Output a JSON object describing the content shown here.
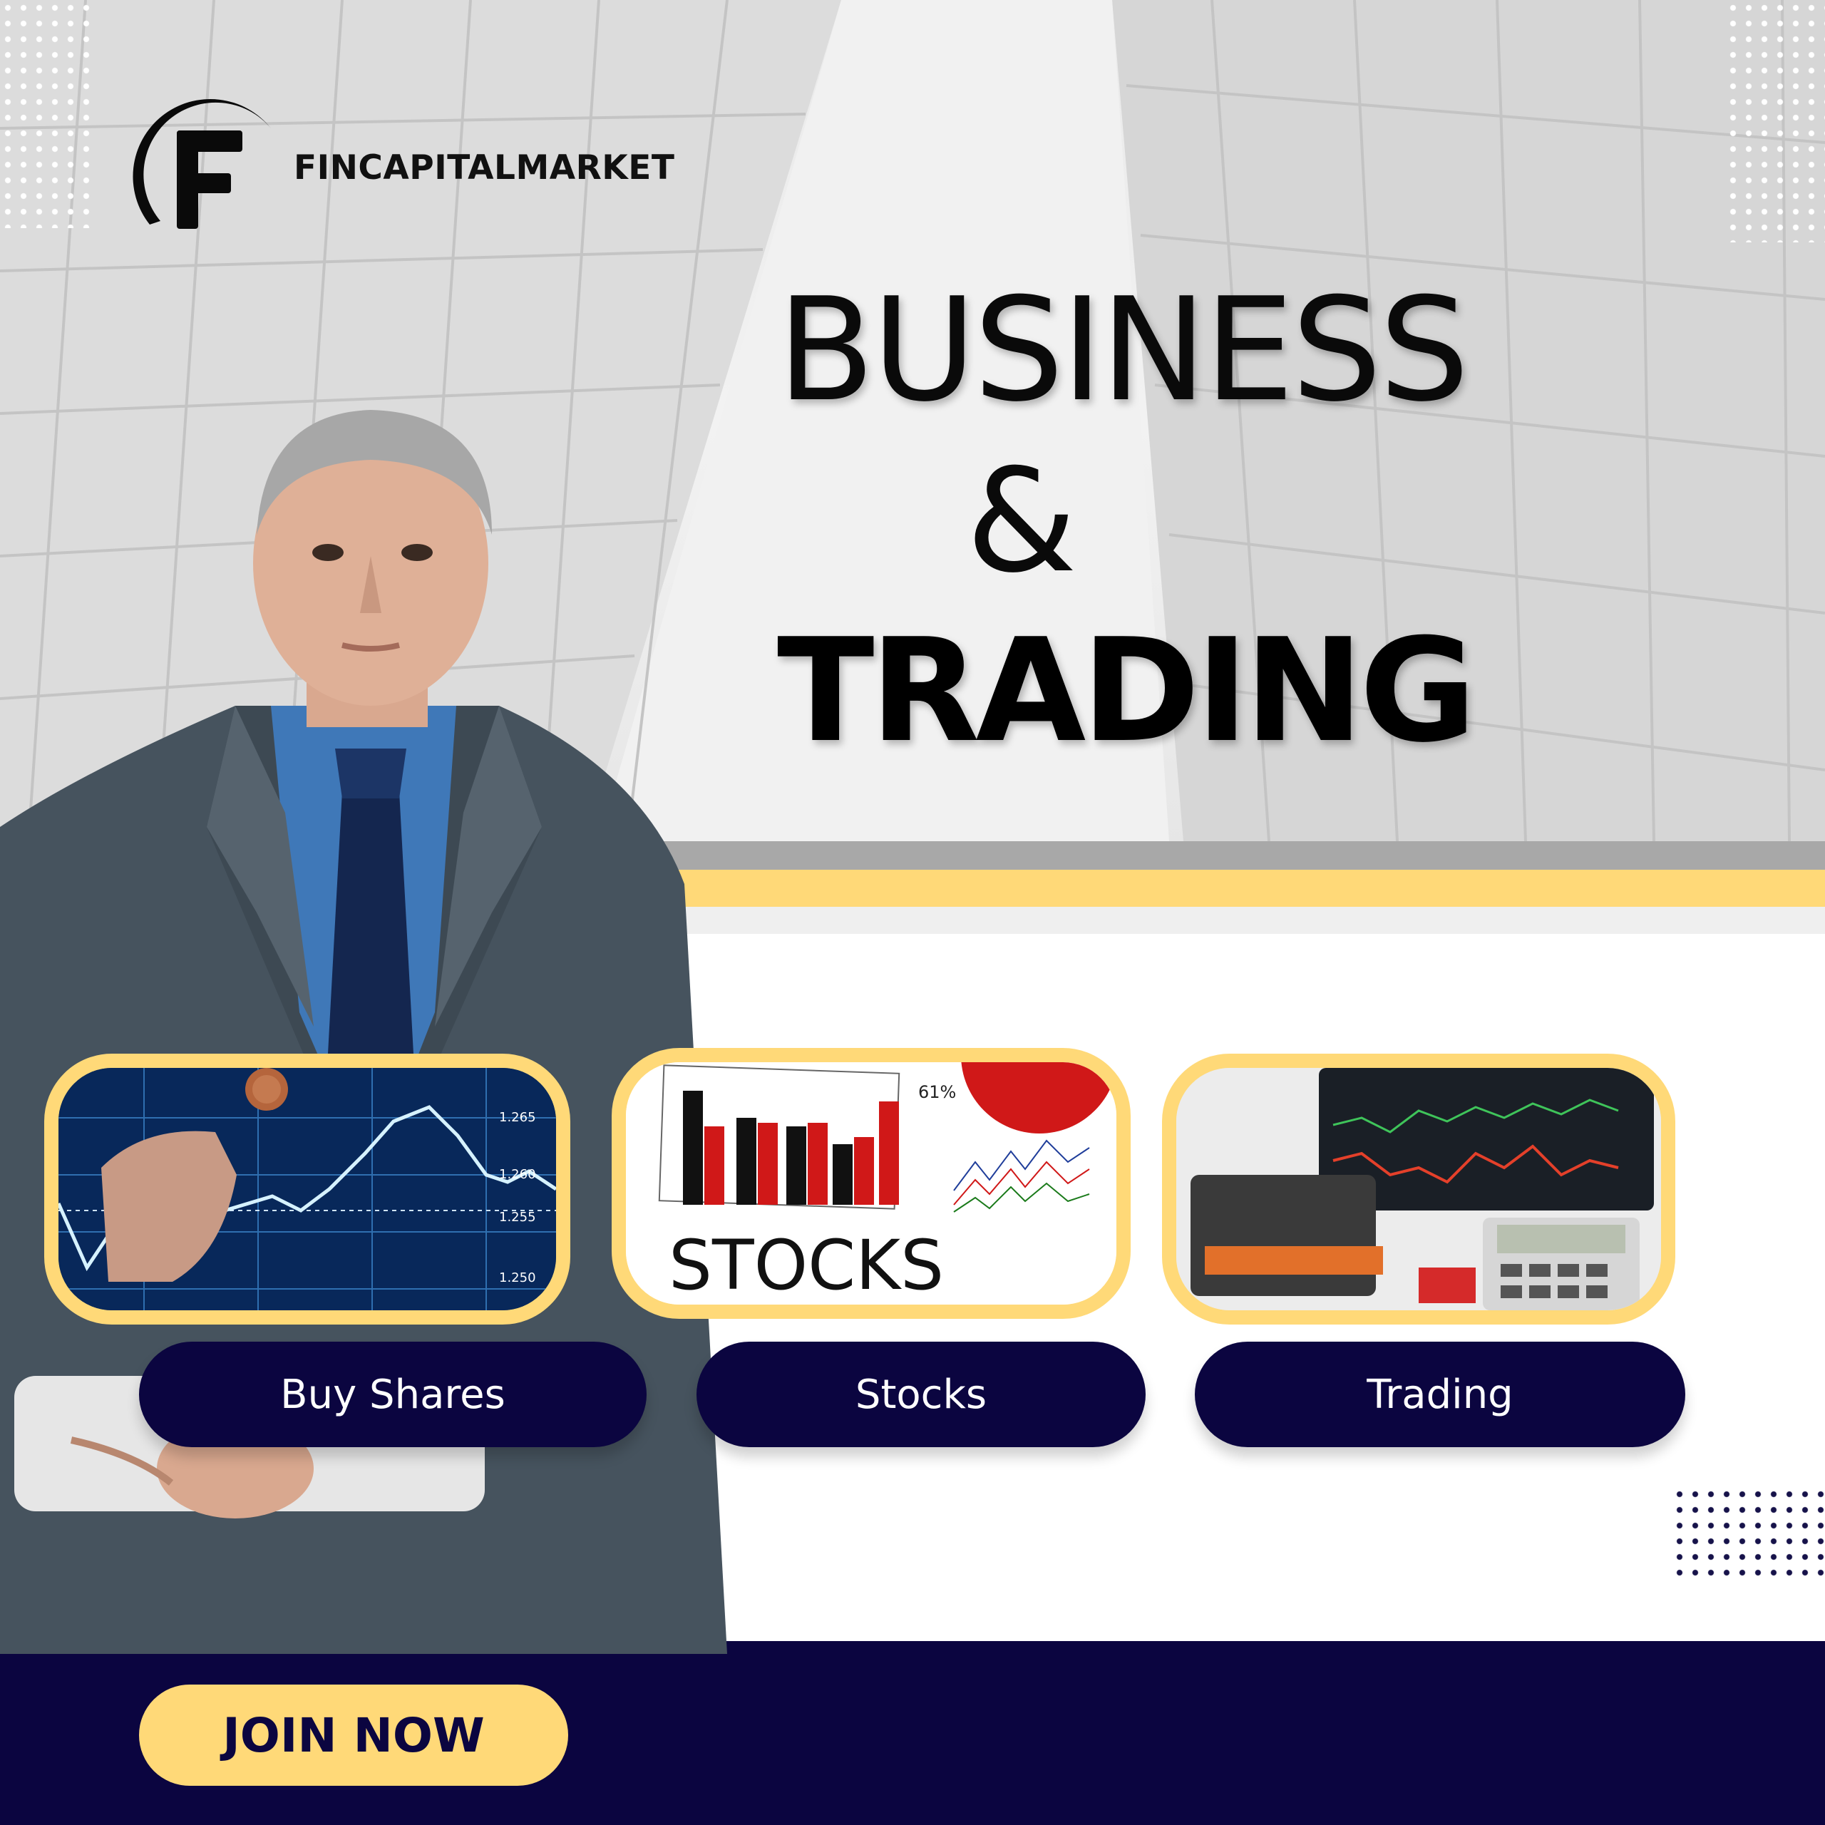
{
  "brand": {
    "name": "FINCAPITALMARKET",
    "logo_letter": "F"
  },
  "headline": {
    "line1": "BUSINESS",
    "line2": "&",
    "line3": "TRADING"
  },
  "cards": [
    {
      "label": "Buy Shares",
      "image_icon": "stock-chart-coin-photo",
      "chart_ticks": [
        "1.265",
        "1.260",
        "1.255",
        "1.250"
      ]
    },
    {
      "label": "Stocks",
      "image_icon": "stocks-bar-chart-photo",
      "image_text": "STOCKS",
      "percent_text": "61%"
    },
    {
      "label": "Trading",
      "image_icon": "trading-desk-photo"
    }
  ],
  "cta": {
    "label": "JOIN NOW"
  },
  "colors": {
    "accent_yellow": "#ffd978",
    "navy": "#0b0540",
    "chart_blue": "#08285a",
    "bar_red": "#d01818"
  }
}
